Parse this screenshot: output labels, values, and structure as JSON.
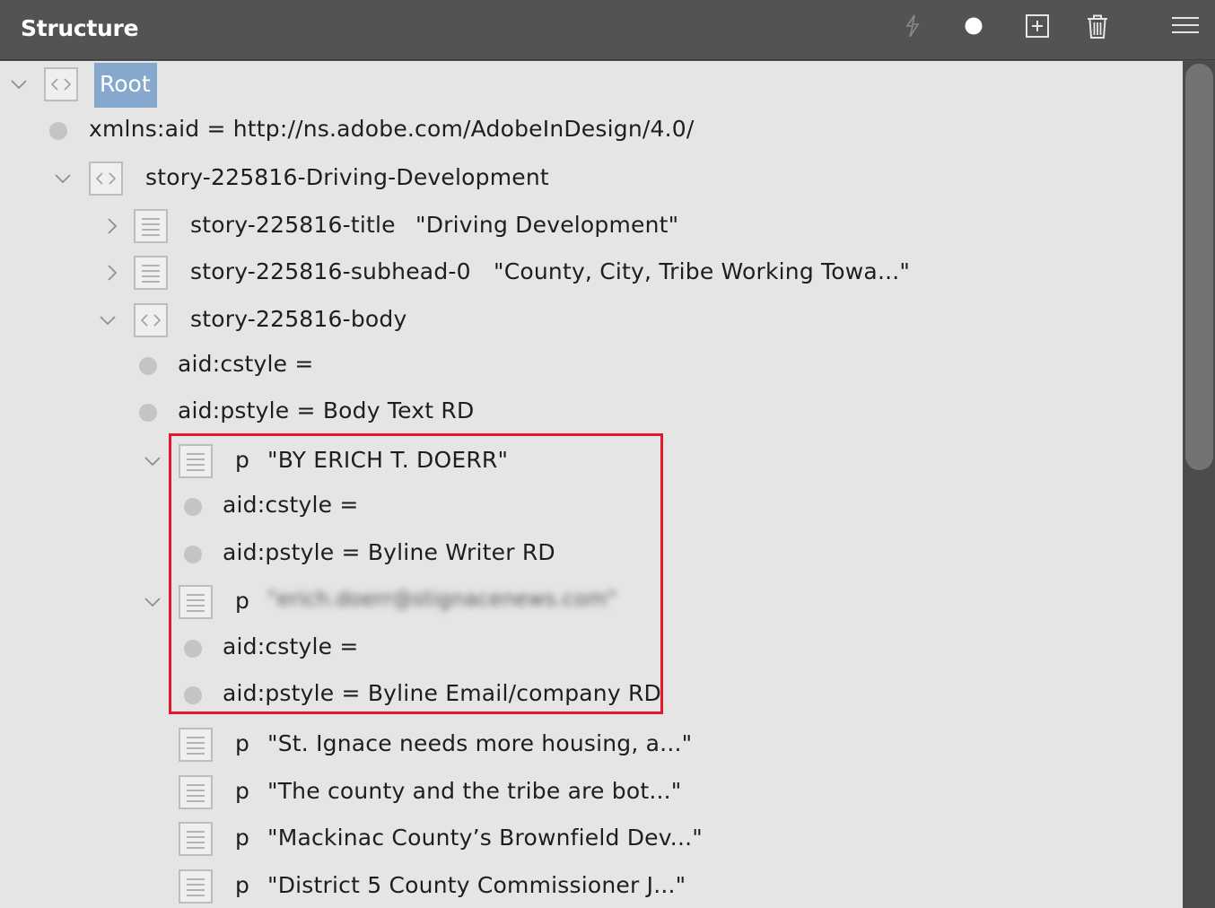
{
  "panel": {
    "title": "Structure",
    "toolbar": {
      "icons": [
        "lightning-icon",
        "record-dot-icon",
        "add-element-icon",
        "trash-icon",
        "menu-icon"
      ]
    }
  },
  "tree": {
    "root": "Root",
    "namespace_attr": "xmlns:aid = http://ns.adobe.com/AdobeInDesign/4.0/",
    "story": "story-225816-Driving-Development",
    "title_tag": "story-225816-title",
    "title_text": "\"Driving Development\"",
    "subhead_tag": "story-225816-subhead-0",
    "subhead_text": "\"County, City, Tribe Working Towa...\"",
    "body_tag": "story-225816-body",
    "body_cstyle": "aid:cstyle =",
    "body_pstyle": "aid:pstyle = Body Text RD",
    "p1_tag": "p",
    "p1_text": "\"BY ERICH T. DOERR\"",
    "p1_cstyle": "aid:cstyle =",
    "p1_pstyle": "aid:pstyle = Byline Writer RD",
    "p2_tag": "p",
    "p2_text": "\"erich.doerr@stignacenews.com\"",
    "p2_cstyle": "aid:cstyle =",
    "p2_pstyle": "aid:pstyle = Byline Email/company RD",
    "paragraphs": [
      {
        "tag": "p",
        "text": "\"St. Ignace needs more housing, a...\""
      },
      {
        "tag": "p",
        "text": "\"The county and the tribe are bot...\""
      },
      {
        "tag": "p",
        "text": "\"Mackinac County’s Brownfield Dev...\""
      },
      {
        "tag": "p",
        "text": "\"District 5 County Commissioner J...\""
      }
    ]
  },
  "colors": {
    "selection": "#86a8cc",
    "highlight_box": "#e3182d"
  }
}
